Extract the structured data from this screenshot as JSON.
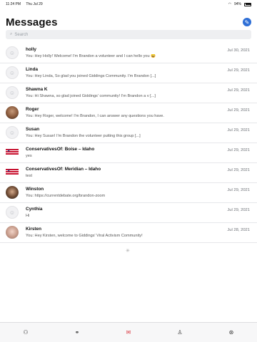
{
  "status_bar": {
    "time": "11:24 PM",
    "date": "Thu Jul 29",
    "battery": "94%"
  },
  "header": {
    "title": "Messages"
  },
  "search": {
    "placeholder": "Search"
  },
  "conversations": [
    {
      "name": "holly",
      "preview": "You:  Hey Holly! Welcome! I'm Brandon a volunteer and I can hello you 😄",
      "date": "Jul 30, 2021",
      "avatar": "generic"
    },
    {
      "name": "Linda",
      "preview": "You:  Hey Linda, So glad you joined Giddings Community. I'm Brandon [...]",
      "date": "Jul 29, 2021",
      "avatar": "generic"
    },
    {
      "name": "Shawna K",
      "preview": "You:  Hi Shawna, so glad joined Giddings' community! I'm Brandon a v [...]",
      "date": "Jul 29, 2021",
      "avatar": "generic"
    },
    {
      "name": "Roger",
      "preview": "You:  Hey Roger, welcome! I'm Brandon, I can answer any questions you have.",
      "date": "Jul 29, 2021",
      "avatar": "photo-roger"
    },
    {
      "name": "Susan",
      "preview": "You:  Hey Susan! I'm Brandon the volunteer putting this group [...]",
      "date": "Jul 29, 2021",
      "avatar": "generic"
    },
    {
      "name": "ConservativesOf: Boise – Idaho",
      "preview": "yes",
      "date": "Jul 29, 2021",
      "avatar": "flag"
    },
    {
      "name": "ConservativesOf: Meridian – Idaho",
      "preview": "test",
      "date": "Jul 29, 2021",
      "avatar": "flag"
    },
    {
      "name": "Winston",
      "preview": "You:  https://currentdebate.org/brandon-zoom",
      "date": "Jul 29, 2021",
      "avatar": "photo-winston"
    },
    {
      "name": "Cynthia",
      "preview": "Hi",
      "date": "Jul 29, 2021",
      "avatar": "generic"
    },
    {
      "name": "Kirsten",
      "preview": "You:  Hey Kirsten, welcome to Giddings' Viral Activism Community!",
      "date": "Jul 28, 2021",
      "avatar": "photo-kirsten"
    }
  ],
  "tabbar": {
    "tabs": [
      {
        "icon": "community-icon",
        "glyph": "⚇",
        "active": false
      },
      {
        "icon": "groups-icon",
        "glyph": "⚭",
        "active": false
      },
      {
        "icon": "mail-icon",
        "glyph": "✉",
        "active": true
      },
      {
        "icon": "profile-icon",
        "glyph": "♙",
        "active": false
      },
      {
        "icon": "settings-icon",
        "glyph": "⊛",
        "active": false
      }
    ]
  },
  "colors": {
    "accent": "#2f6fd6",
    "active_tab": "#d9363e"
  }
}
